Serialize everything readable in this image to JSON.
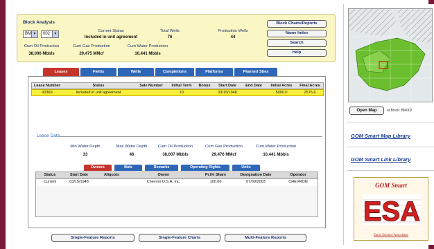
{
  "header": {
    "title": "Block Analysis",
    "area_select": "BM",
    "block_select": "002",
    "current_status_label": "Current Status",
    "current_status_value": "Included in unit agreement",
    "total_wells_label": "Total Wells",
    "total_wells_value": "76",
    "production_wells_label": "Production Wells",
    "production_wells_value": "44",
    "cum_oil_label": "Cum Oil Production",
    "cum_oil_value": "38,006 Mbbls",
    "cum_gas_label": "Cum Gas Production",
    "cum_gas_value": "29,475 MMcf",
    "cum_water_label": "Cum Water Production",
    "cum_water_value": "10,441 Mbbls",
    "buttons": {
      "charts_reports": "Block Charts/Reports",
      "name_index": "Name Index",
      "search": "Search",
      "help": "Help"
    }
  },
  "tabs": [
    "Leases",
    "Fields",
    "Wells",
    "Completions",
    "Platforms",
    "Planned Sites"
  ],
  "active_tab": "Leases",
  "lease_table": {
    "headers": [
      "Lease Number",
      "Status",
      "Sale Number",
      "Initial Term",
      "Bonus",
      "Start Date",
      "End Date",
      "Initial Acres",
      "Final Acres"
    ],
    "rows": [
      [
        "00369",
        "Included in unit agreement",
        "",
        "10",
        "",
        "03/15/1948",
        "",
        "5000.0",
        "2576.6"
      ]
    ]
  },
  "lease_data": {
    "title": "Lease Data",
    "min_water_depth_label": "Min Water Depth",
    "min_water_depth_value": "33",
    "max_water_depth_label": "Max Water Depth",
    "max_water_depth_value": "46",
    "cum_oil_label": "Cum Oil Production",
    "cum_oil_value": "38,007 Mbbls",
    "cum_gas_label": "Cum Gas Production",
    "cum_gas_value": "29,476 MMcf",
    "cum_water_label": "Cum Water Production",
    "cum_water_value": "10,441 Mbbls"
  },
  "sub_tabs": [
    "Owners",
    "Bids",
    "Remarks",
    "Operating Rights",
    "Units"
  ],
  "active_sub_tab": "Owners",
  "owners_table": {
    "headers": [
      "Status",
      "Start Date",
      "Aliquots",
      "Owner",
      "Pct% Share",
      "Designation Date",
      "Operator"
    ],
    "rows": [
      [
        "Current",
        "03/15/1948",
        "",
        "Chevron U.S.A. Inc.",
        "100.00",
        "07/09/2003",
        "CHEVRON"
      ]
    ]
  },
  "bottom_buttons": [
    "Single-Feature Reports",
    "Single-Feature Charts",
    "Multi-Feature Reports"
  ],
  "side": {
    "open_map": "Open Map",
    "at_block": "at Block: BM002",
    "map_library": "GOM Smart Map Library",
    "link_library": "GOM Smart Link Library",
    "logo_title": "GOM Smart",
    "logo_letters": "ESA",
    "logo_footer": "Earth Science Associates"
  },
  "colors": {
    "tab_blue": "#2f67b8",
    "tab_active_red": "#c5342b",
    "header_yellow": "#fbf7c4",
    "row_highlight": "#f8ef3c",
    "frame_maroon": "#7a1a3a"
  }
}
